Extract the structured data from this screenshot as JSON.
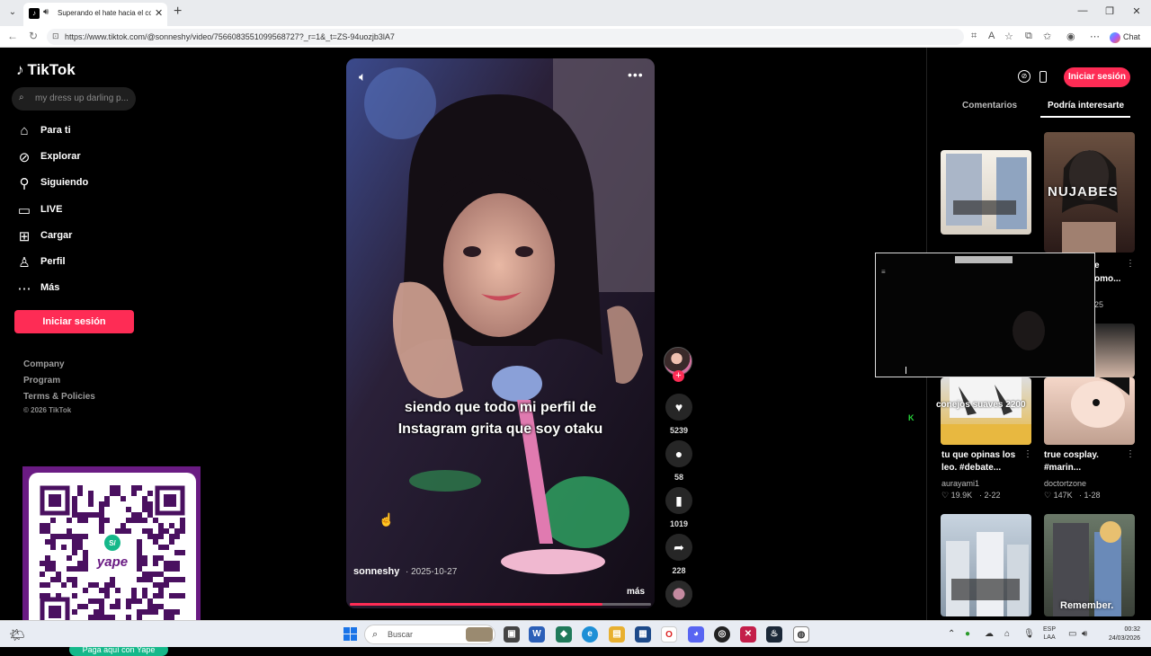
{
  "browser": {
    "tab_title": "Superando el hate hacia el co",
    "url": "https://www.tiktok.com/@sonneshy/video/7566083551099568727?_r=1&_t=ZS-94uozjb3lA7",
    "chat_label": "Chat"
  },
  "sidebar": {
    "logo": "TikTok",
    "search_placeholder": "my dress up darling p...",
    "items": [
      {
        "label": "Para ti",
        "icon": "home-icon"
      },
      {
        "label": "Explorar",
        "icon": "compass-icon"
      },
      {
        "label": "Siguiendo",
        "icon": "user-follow-icon"
      },
      {
        "label": "LIVE",
        "icon": "live-icon"
      },
      {
        "label": "Cargar",
        "icon": "upload-icon"
      },
      {
        "label": "Perfil",
        "icon": "profile-icon"
      },
      {
        "label": "Más",
        "icon": "more-icon"
      }
    ],
    "login_label": "Iniciar sesión",
    "footer": [
      "Company",
      "Program",
      "Terms & Policies"
    ],
    "copyright": "© 2026 TikTok"
  },
  "qr": {
    "footer": "Paga aquí con Yape",
    "brand": "yape"
  },
  "video": {
    "caption_line1": "siendo que todo mi perfil de",
    "caption_line2": "Instagram grita que soy otaku",
    "author": "sonneshy",
    "date": "· 2025-10-27",
    "more_label": "más",
    "progress": 0.84
  },
  "actions": {
    "likes": "5239",
    "comments": "58",
    "saves": "1019",
    "shares": "228"
  },
  "right_panel": {
    "login_label": "Iniciar sesión",
    "tab_comments": "Comentarios",
    "tab_suggest": "Podría interesarte",
    "items": [
      {
        "title_part": "",
        "author": "",
        "stats": ""
      },
      {
        "title_part": "e",
        "title_part2": "omo...",
        "stats": "25",
        "overlay_text": "NUJABES"
      },
      {
        "title": "tu que opinas los leo. #debate...",
        "author": "aurayami1",
        "likes": "♡ 19.9K",
        "date": "· 2-22"
      },
      {
        "title": "true cosplay. #marin...",
        "author": "doctortzone",
        "likes": "♡ 147K",
        "date": "· 1-28"
      },
      {
        "overlay_text": "Remember."
      }
    ],
    "mini_caption": "conejos suaves 2200",
    "green_letter": "K"
  },
  "taskbar": {
    "search_placeholder": "Buscar",
    "lang_line1": "ESP",
    "lang_line2": "LAA",
    "time": "00:32",
    "date": "24/03/2026"
  },
  "colors": {
    "accent": "#fe2c55",
    "qr_frame": "#6a1b83",
    "qr_footer": "#15b88a"
  }
}
